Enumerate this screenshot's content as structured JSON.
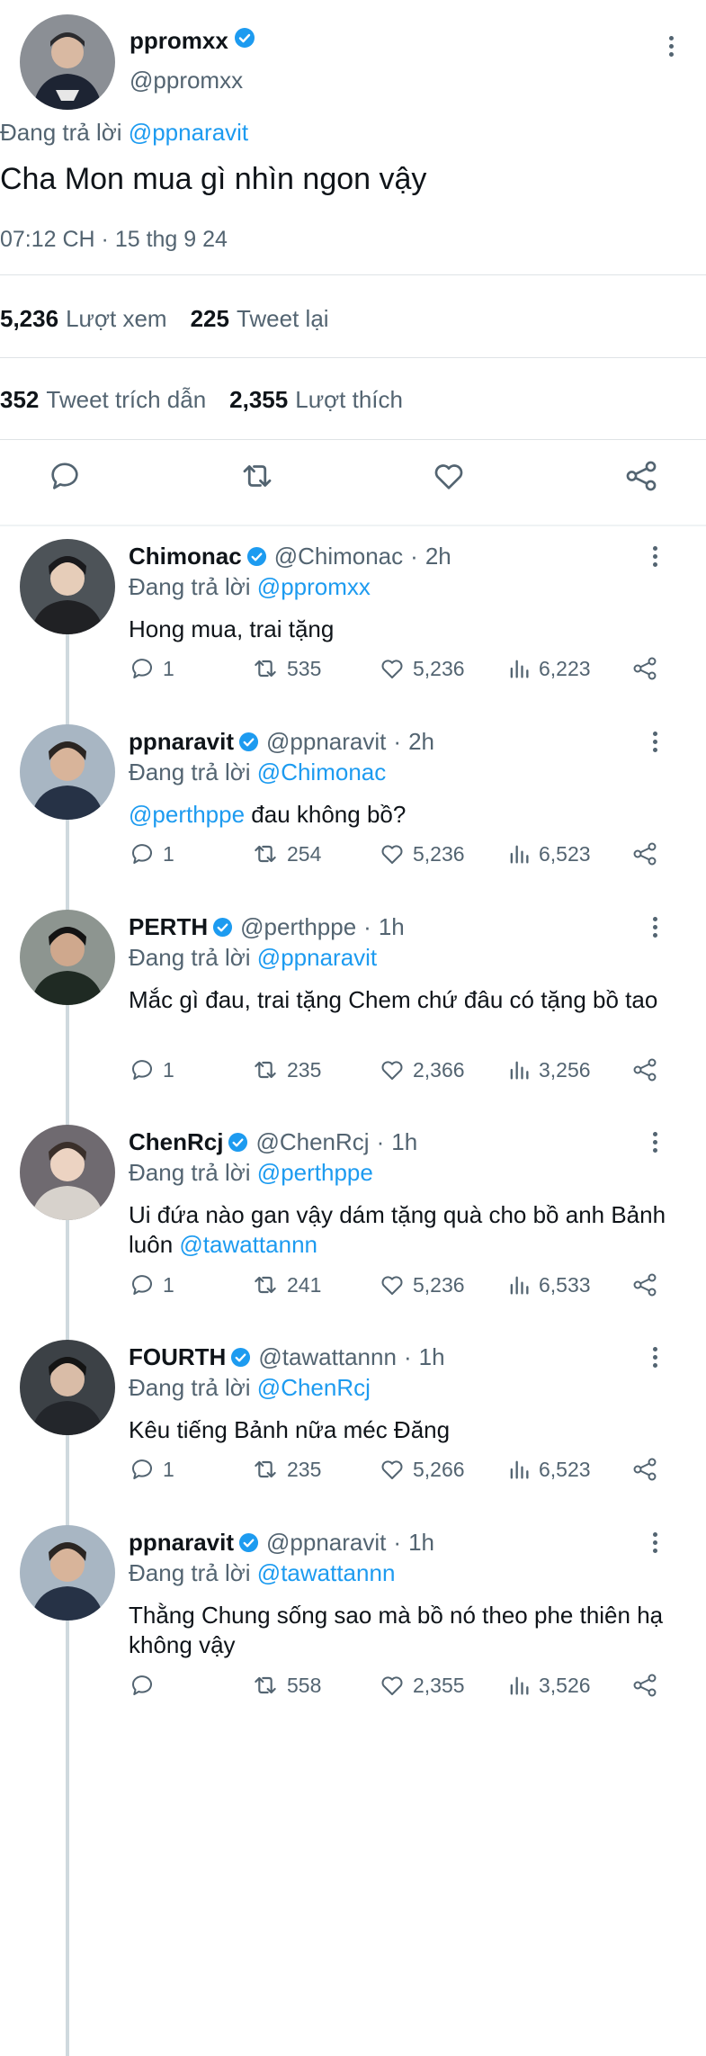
{
  "main_tweet": {
    "name": "ppromxx",
    "handle": "@ppromxx",
    "replying_label": "Đang trả lời",
    "replying_to": "@ppnaravit",
    "text": "Cha Mon mua gì nhìn ngon vậy",
    "timestamp": "07:12 CH · 15 thg 9 24",
    "stats": {
      "views_count": "5,236",
      "views_label": "Lượt xem",
      "retweets_count": "225",
      "retweets_label": "Tweet lại",
      "quotes_count": "352",
      "quotes_label": "Tweet trích dẫn",
      "likes_count": "2,355",
      "likes_label": "Lượt thích"
    },
    "actions": [
      "reply-icon",
      "retweet-icon",
      "like-icon",
      "share-icon"
    ]
  },
  "colors": {
    "accent": "#1d9bf0",
    "muted": "#536471",
    "text": "#0f1419",
    "divider": "#dfe3e6"
  },
  "replies": [
    {
      "name": "Chimonac",
      "handle": "@Chimonac",
      "time": "2h",
      "replying_label": "Đang trả lời",
      "replying_to": "@ppromxx",
      "text_before": "",
      "text_mention": "",
      "text_after": "Hong mua, trai tặng",
      "replies": "1",
      "retweets": "535",
      "likes": "5,236",
      "views": "6,223"
    },
    {
      "name": "ppnaravit",
      "handle": "@ppnaravit",
      "time": "2h",
      "replying_label": "Đang trả lời",
      "replying_to": "@Chimonac",
      "text_before": "",
      "text_mention": "@perthppe",
      "text_after": " đau không bồ?",
      "replies": "1",
      "retweets": "254",
      "likes": "5,236",
      "views": "6,523"
    },
    {
      "name": "PERTH",
      "handle": "@perthppe",
      "time": "1h",
      "replying_label": "Đang trả lời",
      "replying_to": "@ppnaravit",
      "text_before": "",
      "text_mention": "",
      "text_after": "Mắc gì đau, trai tặng Chem chứ đâu có tặng bồ tao",
      "replies": "1",
      "retweets": "235",
      "likes": "2,366",
      "views": "3,256"
    },
    {
      "name": "ChenRcj",
      "handle": "@ChenRcj",
      "time": "1h",
      "replying_label": "Đang trả lời",
      "replying_to": "@perthppe",
      "text_before": "Ui đứa nào gan vậy dám tặng quà cho bồ anh Bảnh luôn ",
      "text_mention": "@tawattannn",
      "text_after": "",
      "replies": "1",
      "retweets": "241",
      "likes": "5,236",
      "views": "6,533"
    },
    {
      "name": "FOURTH",
      "handle": "@tawattannn",
      "time": "1h",
      "replying_label": "Đang trả lời",
      "replying_to": "@ChenRcj",
      "text_before": "",
      "text_mention": "",
      "text_after": "Kêu tiếng Bảnh nữa méc Đăng",
      "replies": "1",
      "retweets": "235",
      "likes": "5,266",
      "views": "6,523"
    },
    {
      "name": "ppnaravit",
      "handle": "@ppnaravit",
      "time": "1h",
      "replying_label": "Đang trả lời",
      "replying_to": "@tawattannn",
      "text_before": "",
      "text_mention": "",
      "text_after": "Thằng Chung sống sao mà bồ nó theo phe thiên hạ không vậy",
      "replies": "",
      "retweets": "558",
      "likes": "2,355",
      "views": "3,526"
    }
  ]
}
